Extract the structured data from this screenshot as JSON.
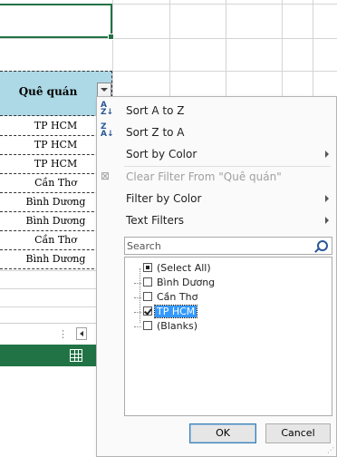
{
  "sheet": {
    "header": "Quê quán",
    "rows": [
      "TP HCM",
      "TP HCM",
      "TP HCM",
      "Cần Thơ",
      "Bình Dương",
      "Bình Dương",
      "Cần Thơ",
      "Bình Dương"
    ]
  },
  "menu": {
    "sort_az": "Sort A to Z",
    "sort_za": "Sort Z to A",
    "sort_by_color": "Sort by Color",
    "clear_filter": "Clear Filter From \"Quê quán\"",
    "filter_by_color": "Filter by Color",
    "text_filters": "Text Filters",
    "search_placeholder": "Search",
    "items": [
      {
        "label": "(Select All)",
        "state": "partial"
      },
      {
        "label": "Bình Dương",
        "state": "unchecked"
      },
      {
        "label": "Cần Thơ",
        "state": "unchecked"
      },
      {
        "label": "TP HCM",
        "state": "checked"
      },
      {
        "label": "(Blanks)",
        "state": "unchecked"
      }
    ],
    "ok": "OK",
    "cancel": "Cancel"
  },
  "icons": {
    "sort_az": "sort-a-z-icon",
    "sort_za": "sort-z-a-icon",
    "clear_filter": "clear-filter-icon",
    "search": "search-icon",
    "sheet_view": "normal-view-icon"
  },
  "colors": {
    "header_fill": "#add8e6",
    "excel_green": "#217346",
    "selection_blue": "#3399ff"
  }
}
